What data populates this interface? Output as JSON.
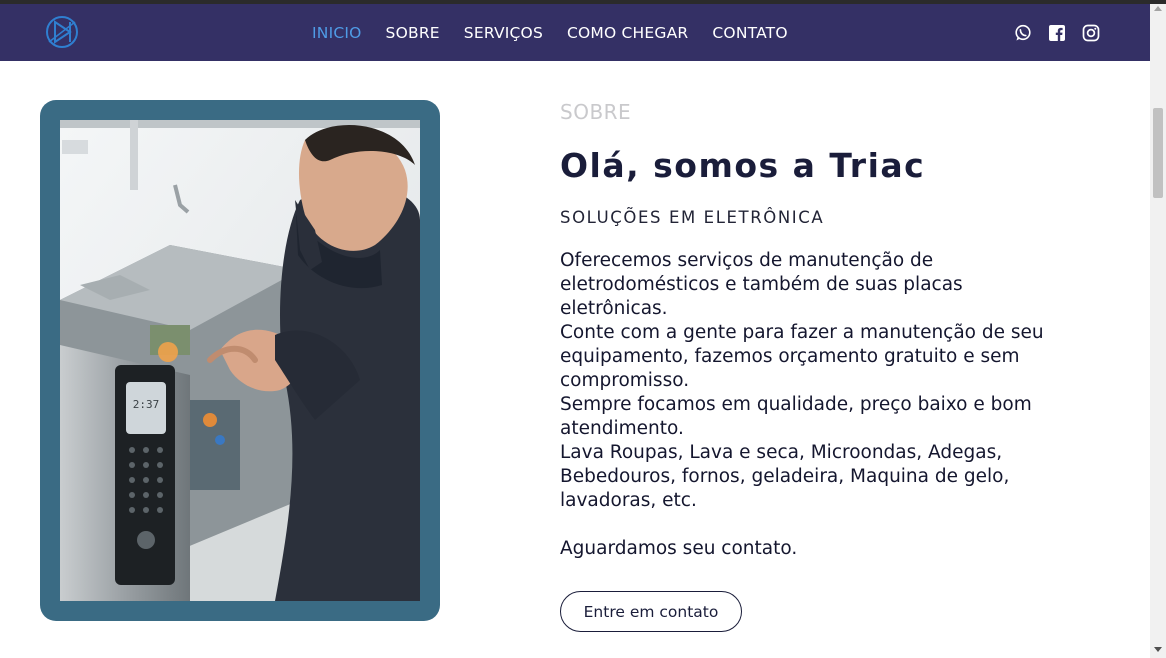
{
  "nav": {
    "logo": "triac-logo",
    "links": [
      {
        "label": "INICIO",
        "active": true
      },
      {
        "label": "SOBRE",
        "active": false
      },
      {
        "label": "SERVIÇOS",
        "active": false
      },
      {
        "label": "COMO CHEGAR",
        "active": false
      },
      {
        "label": "CONTATO",
        "active": false
      }
    ],
    "social": [
      "whatsapp-icon",
      "facebook-icon",
      "instagram-icon"
    ]
  },
  "about": {
    "section_label": "SOBRE",
    "headline": "Olá, somos a Triac",
    "subheadline": "SOLUÇÕES EM ELETRÔNICA",
    "paragraphs": [
      "Oferecemos serviços de manutenção de eletrodomésticos e também de suas placas eletrônicas.",
      "Conte com a gente para fazer a manutenção de seu equipamento, fazemos orçamento gratuito e sem compromisso.",
      "Sempre focamos em qualidade, preço baixo e bom atendimento.",
      "Lava Roupas, Lava e seca, Microondas, Adegas, Bebedouros, fornos, geladeira, Maquina de gelo, lavadoras, etc."
    ],
    "closing": "Aguardamos seu contato.",
    "cta_label": "Entre em contato",
    "microwave_display": "2:37"
  },
  "colors": {
    "navbar": "#343065",
    "nav_active": "#4f9be6",
    "frame": "#3a6b84",
    "heading": "#1a1d3a"
  }
}
